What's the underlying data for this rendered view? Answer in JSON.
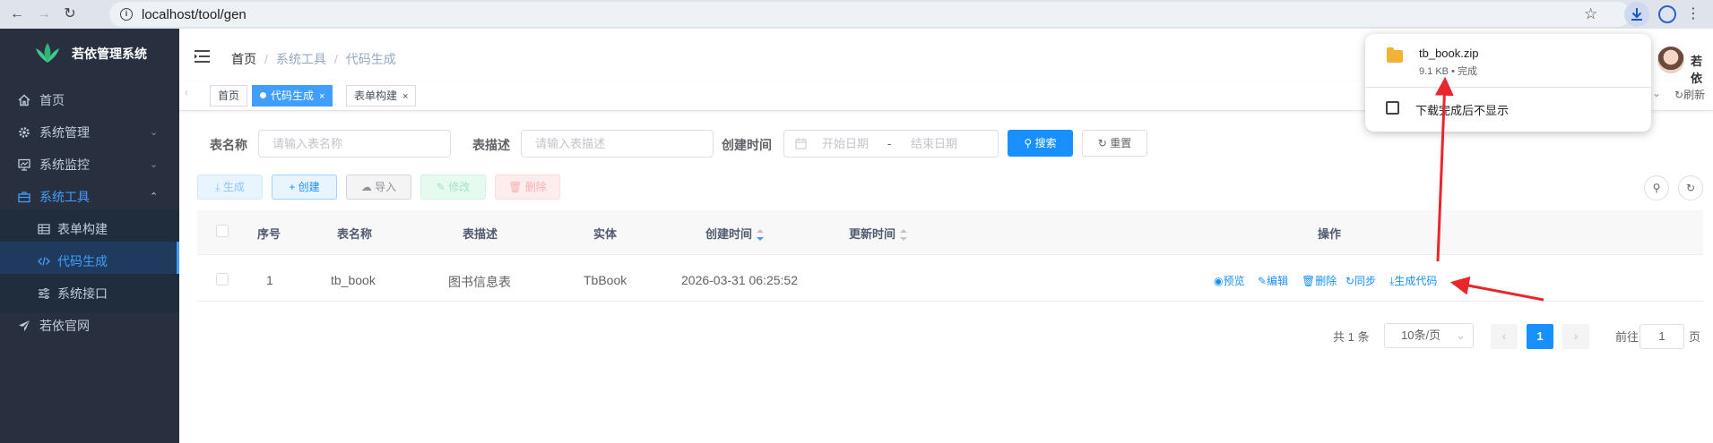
{
  "browser": {
    "url": "localhost/tool/gen"
  },
  "app": {
    "name": "若依管理系统"
  },
  "sidebar": {
    "items": [
      {
        "label": "首页",
        "icon": "home-icon"
      },
      {
        "label": "系统管理",
        "icon": "gear-icon"
      },
      {
        "label": "系统监控",
        "icon": "monitor-icon"
      },
      {
        "label": "系统工具",
        "icon": "toolbox-icon"
      },
      {
        "label": "表单构建",
        "icon": "table-icon"
      },
      {
        "label": "代码生成",
        "icon": "code-icon"
      },
      {
        "label": "系统接口",
        "icon": "sliders-icon"
      },
      {
        "label": "若依官网",
        "icon": "paper-plane-icon"
      }
    ]
  },
  "breadcrumb": [
    "首页",
    "系统工具",
    "代码生成"
  ],
  "tags": [
    {
      "label": "首页"
    },
    {
      "label": "代码生成",
      "active": true
    },
    {
      "label": "表单构建"
    }
  ],
  "tags_right": "刷新",
  "user": {
    "name": "若依"
  },
  "search": {
    "table_name_label": "表名称",
    "table_name_placeholder": "请输入表名称",
    "table_desc_label": "表描述",
    "table_desc_placeholder": "请输入表描述",
    "create_time_label": "创建时间",
    "start_placeholder": "开始日期",
    "range_sep": "-",
    "end_placeholder": "结束日期",
    "search_btn": "搜索",
    "reset_btn": "重置"
  },
  "toolbar": {
    "generate": "生成",
    "create": "创建",
    "import": "导入",
    "edit": "修改",
    "delete": "删除"
  },
  "table": {
    "headers": [
      "序号",
      "表名称",
      "表描述",
      "实体",
      "创建时间",
      "更新时间",
      "操作"
    ],
    "rows": [
      {
        "index": "1",
        "table_name": "tb_book",
        "table_desc": "图书信息表",
        "entity": "TbBook",
        "create_time": "2026-03-31 06:25:52",
        "update_time": ""
      }
    ],
    "ops": [
      "预览",
      "编辑",
      "删除",
      "同步",
      "生成代码"
    ]
  },
  "pagination": {
    "total": "共 1 条",
    "page_size": "10条/页",
    "current": "1",
    "goto_label": "前往",
    "goto_value": "1",
    "page_suffix": "页"
  },
  "download": {
    "filename": "tb_book.zip",
    "status": "9.1 KB • 完成",
    "dont_show_label": "下载完成后不显示"
  },
  "colors": {
    "primary": "#1890ff",
    "sidebar_bg": "#28303f",
    "annotation_arrow": "#e8262c"
  }
}
